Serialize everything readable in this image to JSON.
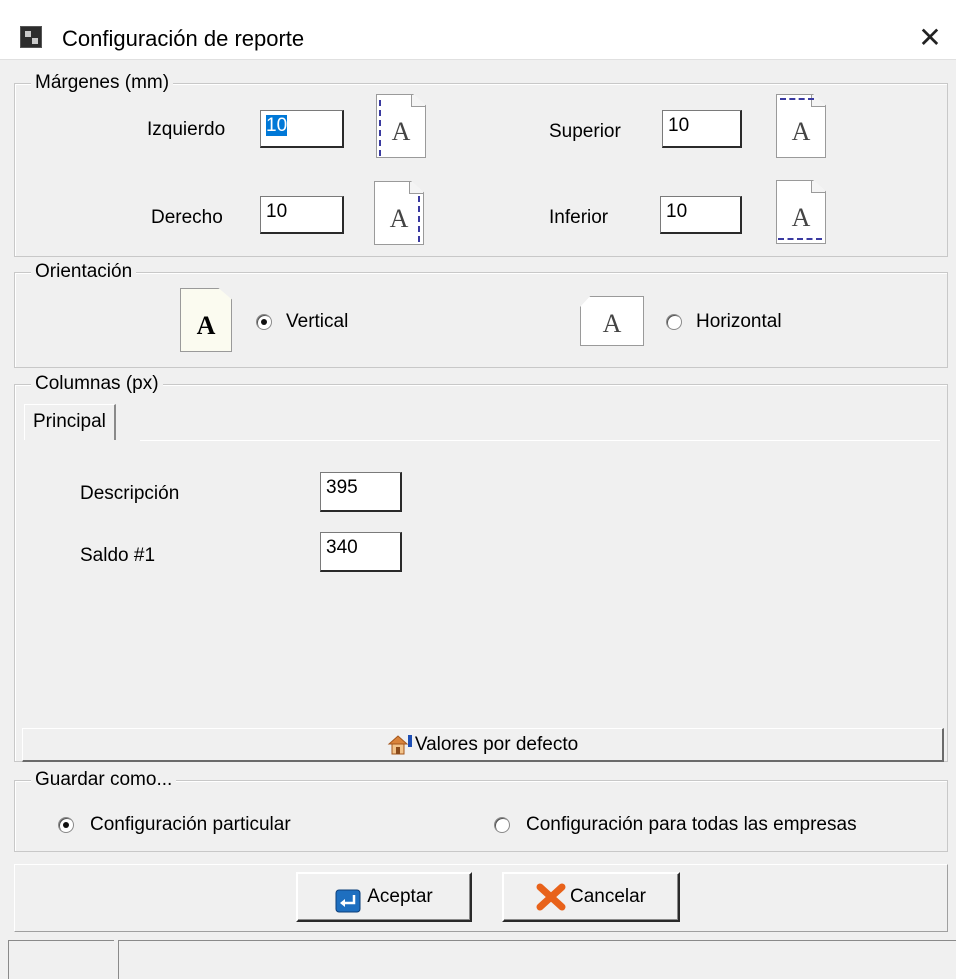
{
  "window": {
    "title": "Configuración de reporte",
    "close_symbol": "✕"
  },
  "margins": {
    "legend": "Márgenes (mm)",
    "left_label": "Izquierdo",
    "left_value": "10",
    "top_label": "Superior",
    "top_value": "10",
    "right_label": "Derecho",
    "right_value": "10",
    "bottom_label": "Inferior",
    "bottom_value": "10",
    "page_letter": "A"
  },
  "orientation": {
    "legend": "Orientación",
    "vertical_label": "Vertical",
    "horizontal_label": "Horizontal",
    "selected": "Vertical",
    "page_letter": "A"
  },
  "columns": {
    "legend": "Columnas (px)",
    "tab_label": "Principal",
    "rows": [
      {
        "label": "Descripción",
        "value": "395"
      },
      {
        "label": "Saldo #1",
        "value": "340"
      }
    ],
    "defaults_button_label": "Valores por defecto"
  },
  "save_as": {
    "legend": "Guardar como...",
    "particular_label": "Configuración particular",
    "all_companies_label": "Configuración para todas las empresas",
    "selected": "Configuración particular"
  },
  "buttons": {
    "accept_label": "Aceptar",
    "cancel_label": "Cancelar"
  },
  "icons": {
    "app": "app-icon",
    "close": "close-icon",
    "accept": "enter-icon",
    "cancel": "red-x-icon",
    "defaults": "house-icon"
  },
  "colors": {
    "selection": "#0078d7",
    "cancel_x": "#e8621a",
    "accept_icon": "#1e6fc0",
    "margin_dash": "#3a3aa0"
  }
}
